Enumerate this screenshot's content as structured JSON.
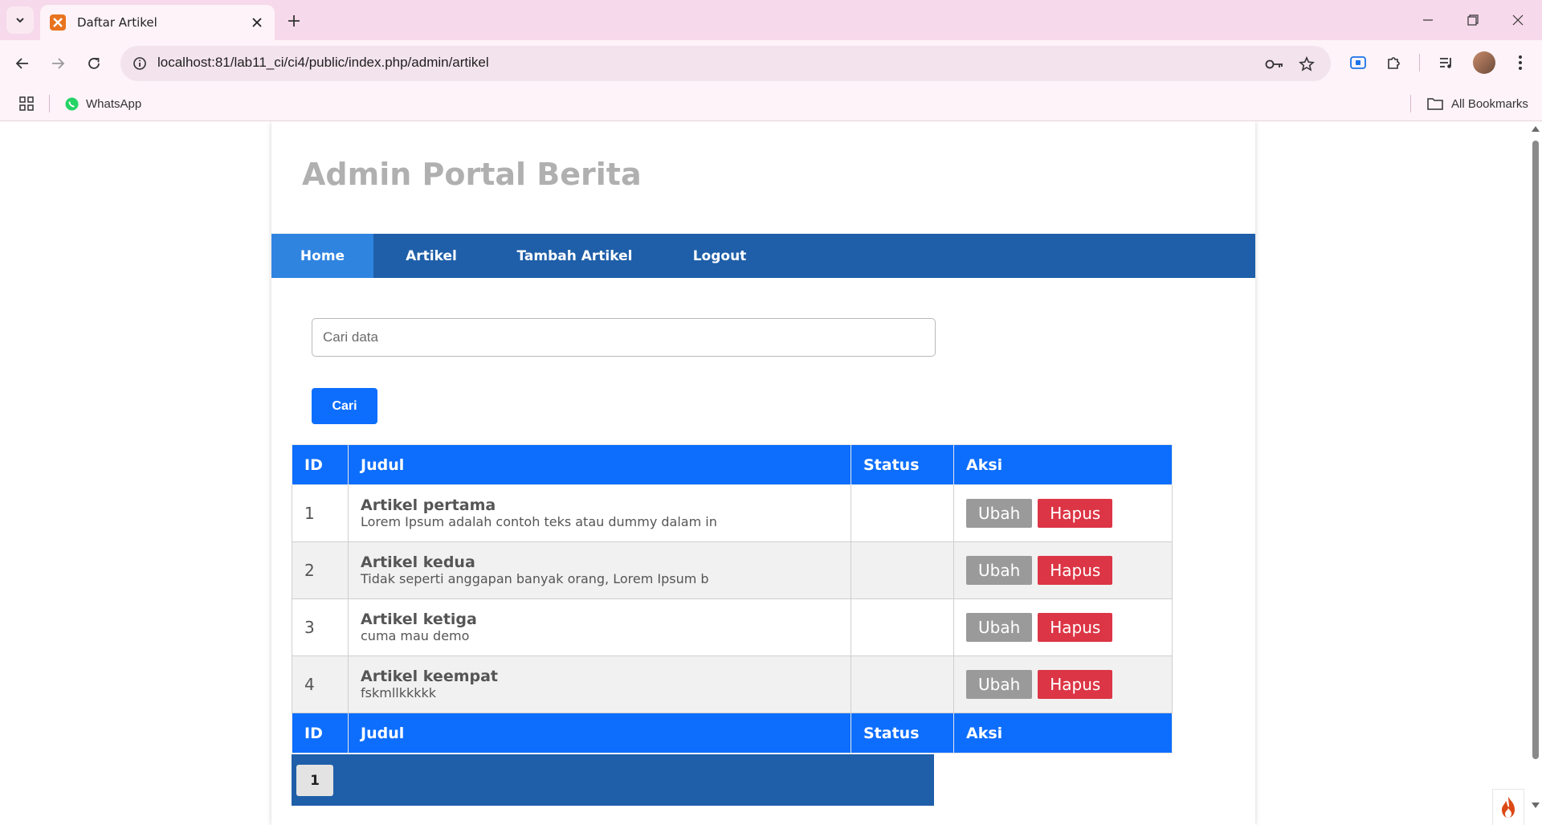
{
  "browser": {
    "tab_title": "Daftar Artikel",
    "url": "localhost:81/lab11_ci/ci4/public/index.php/admin/artikel",
    "bookmarks": [
      {
        "label": "WhatsApp"
      }
    ],
    "all_bookmarks_label": "All Bookmarks"
  },
  "site": {
    "title": "Admin Portal Berita"
  },
  "nav": {
    "items": [
      {
        "label": "Home",
        "active": true
      },
      {
        "label": "Artikel",
        "active": false
      },
      {
        "label": "Tambah Artikel",
        "active": false
      },
      {
        "label": "Logout",
        "active": false
      }
    ]
  },
  "search": {
    "placeholder": "Cari data",
    "button_label": "Cari"
  },
  "table": {
    "headers": [
      "ID",
      "Judul",
      "Status",
      "Aksi"
    ],
    "footer": [
      "ID",
      "Judul",
      "Status",
      "Aksi"
    ],
    "edit_label": "Ubah",
    "delete_label": "Hapus",
    "rows": [
      {
        "id": "1",
        "title": "Artikel pertama",
        "excerpt": "Lorem Ipsum adalah contoh teks atau dummy dalam in",
        "status": ""
      },
      {
        "id": "2",
        "title": "Artikel kedua",
        "excerpt": "Tidak seperti anggapan banyak orang, Lorem Ipsum b",
        "status": ""
      },
      {
        "id": "3",
        "title": "Artikel ketiga",
        "excerpt": "cuma mau demo",
        "status": ""
      },
      {
        "id": "4",
        "title": "Artikel keempat",
        "excerpt": "fskmllkkkkk",
        "status": ""
      }
    ]
  },
  "pagination": {
    "pages": [
      "1"
    ]
  },
  "colors": {
    "nav_bg": "#1f5fa9",
    "nav_active": "#2f84e0",
    "table_header": "#0d6efd",
    "primary_button": "#0d6efd",
    "edit_button": "#9a9a9a",
    "delete_button": "#dc3545",
    "title_gray": "#b0b0b0"
  }
}
